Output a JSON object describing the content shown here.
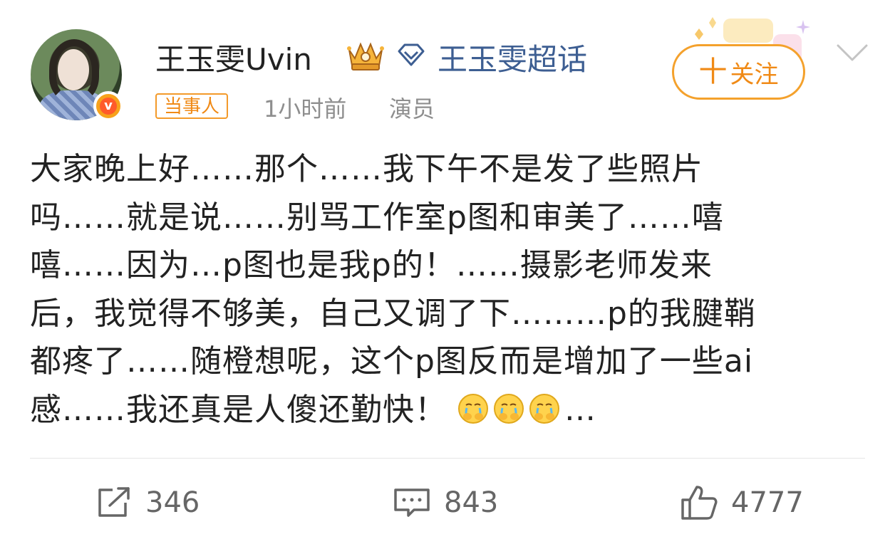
{
  "header": {
    "user_name": "王玉雯Uvin",
    "supertopic_label": "王玉雯超话",
    "badge_label": "当事人",
    "time": "1小时前",
    "role": "演员",
    "follow_label": "关注",
    "follow_plus": "十",
    "verified_glyph": "v"
  },
  "post": {
    "lines": [
      "大家晚上好……那个……我下午不是发了些照片",
      "吗……就是说……别骂工作室p图和审美了……嘻",
      "嘻……因为…p图也是我p的！……摄影老师发来",
      "后，我觉得不够美，自己又调了下………p的我腱鞘",
      "都疼了……随橙想呢，这个p图反而是增加了一些ai",
      "感……我还真是人傻还勤快！",
      "…"
    ],
    "emoji_name": "crying-emoji"
  },
  "actions": {
    "repost_count": "346",
    "comment_count": "843",
    "like_count": "4777"
  },
  "colors": {
    "accent_orange": "#f08a16",
    "link_blue": "#3d5e92",
    "text": "#222222",
    "muted": "#8e8e8e"
  }
}
